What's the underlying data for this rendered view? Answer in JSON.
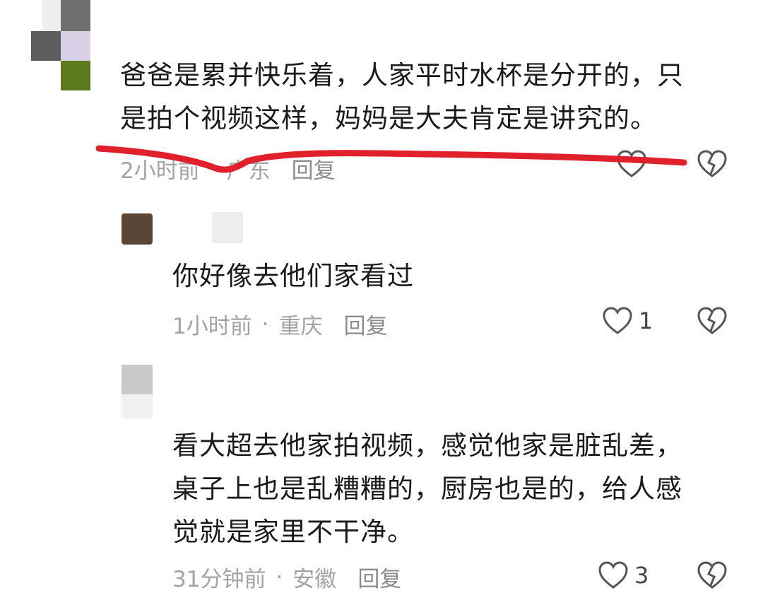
{
  "comments": [
    {
      "text_lines": [
        "爸爸是累并快乐着，人家平时水杯是分开的，只",
        "是拍个视频这样，妈妈是大夫肯定是讲究的。"
      ],
      "time": "2小时前",
      "location": "广东",
      "reply_label": "回复",
      "like_count": ""
    },
    {
      "text_lines": [
        "你好像去他们家看过"
      ],
      "time": "1小时前",
      "location": "重庆",
      "reply_label": "回复",
      "like_count": "1"
    },
    {
      "text_lines": [
        "看大超去他家拍视频，感觉他家是脏乱差，",
        "桌子上也是乱糟糟的，厨房也是的，给人感",
        "觉就是家里不干净。"
      ],
      "time": "31分钟前",
      "location": "安徽",
      "reply_label": "回复",
      "like_count": "3"
    }
  ],
  "dot": "·",
  "colors": {
    "annotation": "#e0202a",
    "meta": "#a3a3a3",
    "text": "#1a1a1a"
  },
  "icons": {
    "like": "heart-outline-icon",
    "dislike": "broken-heart-icon"
  }
}
